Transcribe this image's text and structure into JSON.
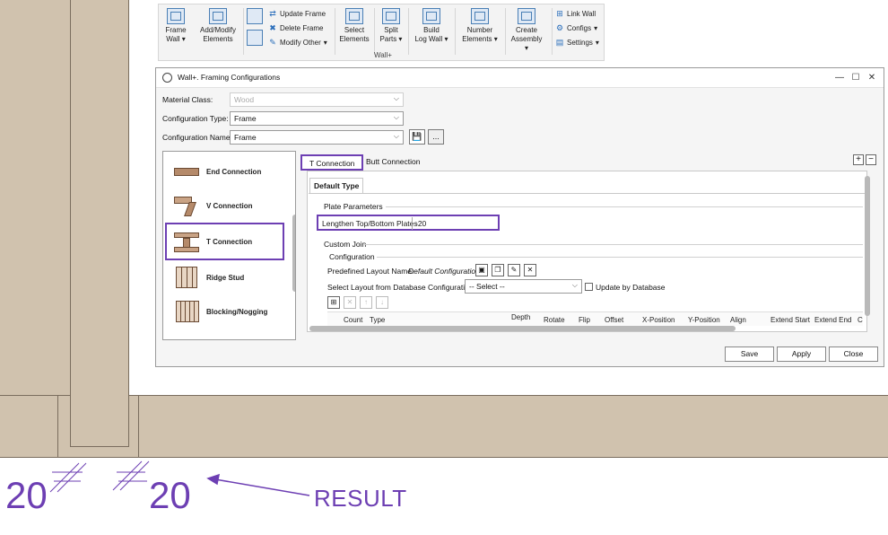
{
  "ribbon": {
    "buttons": [
      {
        "label1": "Frame",
        "label2": "Wall"
      },
      {
        "label1": "Add/Modify",
        "label2": "Elements"
      },
      {
        "label1": "Select",
        "label2": "Elements"
      },
      {
        "label1": "Split",
        "label2": "Parts"
      },
      {
        "label1": "Build",
        "label2": "Log Wall"
      },
      {
        "label1": "Number",
        "label2": "Elements"
      },
      {
        "label1": "Create",
        "label2": "Assembly"
      }
    ],
    "small": [
      "Update Frame",
      "Delete Frame",
      "Modify Other",
      "Link Wall",
      "Configs",
      "Settings"
    ],
    "group_label": "Wall+"
  },
  "dialog": {
    "title": "Wall+. Framing Configurations",
    "material_class_label": "Material Class:",
    "material_class_value": "Wood",
    "config_type_label": "Configuration Type:",
    "config_type_value": "Frame",
    "config_name_label": "Configuration Name:",
    "config_name_value": "Frame",
    "browse_label": "...",
    "connections": [
      "End Connection",
      "V Connection",
      "T Connection",
      "Ridge Stud",
      "Blocking/Nogging"
    ],
    "selected_connection": "T Connection",
    "tabs": [
      "T Connection",
      "Butt Connection"
    ],
    "subtab": "Default Type",
    "plate_params_title": "Plate Parameters",
    "lengthen_label": "Lengthen Top/Bottom Plates",
    "lengthen_value": "-20",
    "custom_join_title": "Custom Join",
    "configuration_title": "Configuration",
    "predefined_label": "Predefined Layout Name:",
    "predefined_value": "Default Configuration",
    "select_layout_label": "Select Layout from Database Configuration:",
    "select_layout_value": "-- Select --",
    "update_db_label": "Update by Database",
    "columns": [
      "Count",
      "Type",
      "Depth",
      "Rotate",
      "Flip",
      "Offset",
      "X-Position",
      "Y-Position",
      "Align",
      "Extend Start",
      "Extend End",
      "C"
    ],
    "buttons": {
      "save": "Save",
      "apply": "Apply",
      "close": "Close"
    }
  },
  "annotation": {
    "dim_left": "20",
    "dim_right": "20",
    "result_label": "RESULT"
  },
  "colors": {
    "accent": "#6d3fb3",
    "wall": "#d0c2ae"
  }
}
